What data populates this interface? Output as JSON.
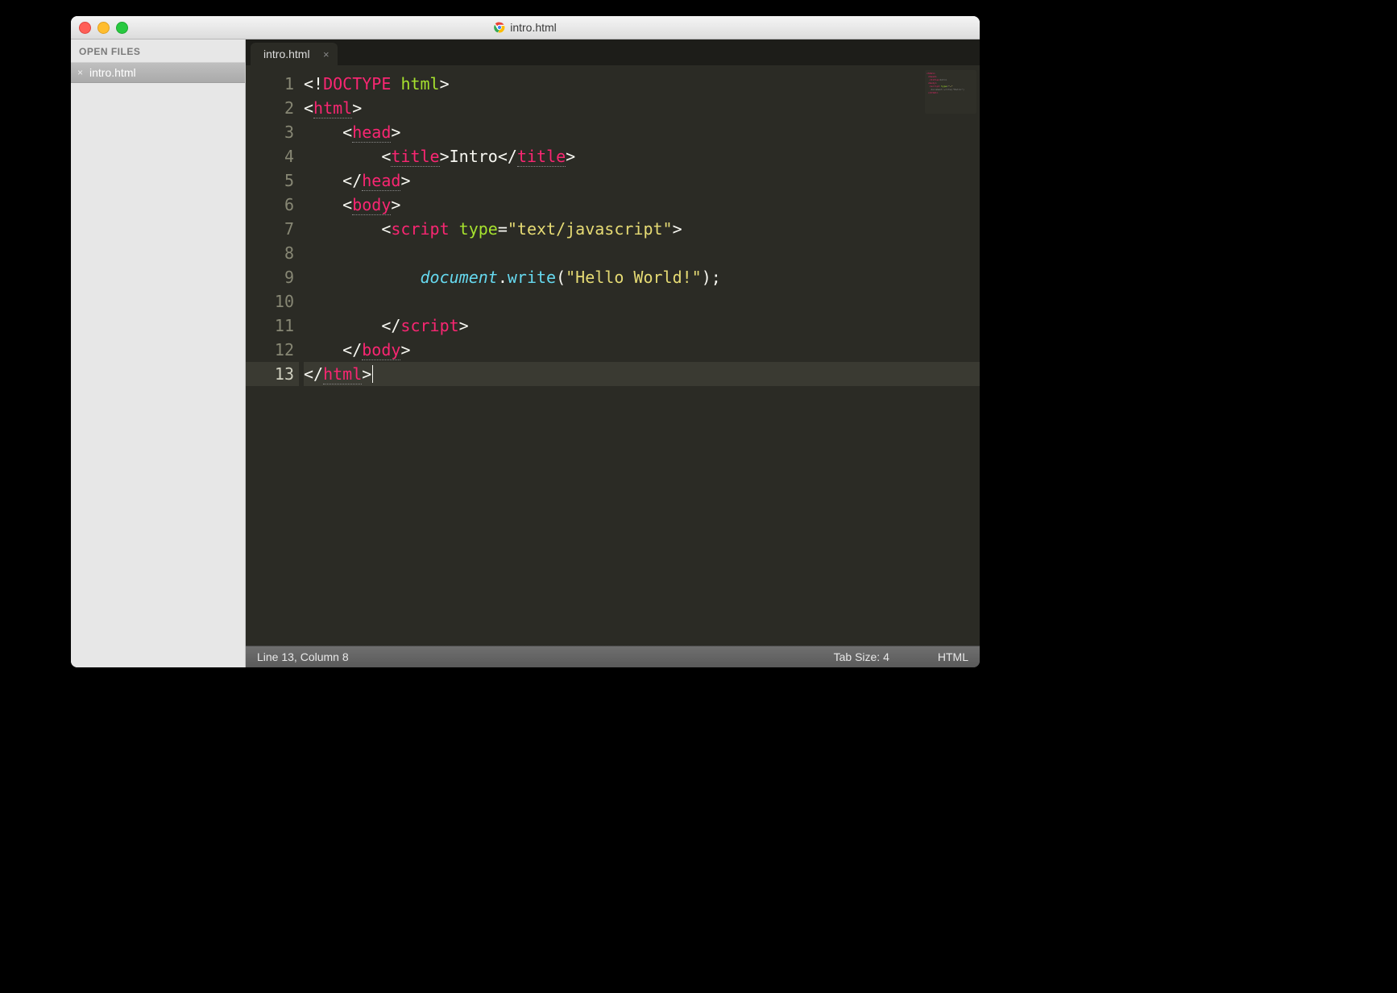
{
  "window": {
    "title": "intro.html"
  },
  "sidebar": {
    "header": "OPEN FILES",
    "open_files": [
      {
        "name": "intro.html"
      }
    ]
  },
  "tabs": [
    {
      "label": "intro.html",
      "active": true
    }
  ],
  "editor": {
    "active_line": 13,
    "lines": [
      {
        "n": 1,
        "tokens": [
          [
            "punc",
            "<!"
          ],
          [
            "tag",
            "DOCTYPE"
          ],
          [
            "plain",
            " "
          ],
          [
            "attr",
            "html"
          ],
          [
            "punc",
            ">"
          ]
        ]
      },
      {
        "n": 2,
        "tokens": [
          [
            "punc",
            "<"
          ],
          [
            "tag",
            "html"
          ],
          [
            "punc",
            ">"
          ]
        ]
      },
      {
        "n": 3,
        "indent": 1,
        "tokens": [
          [
            "punc",
            "<"
          ],
          [
            "tag",
            "head"
          ],
          [
            "punc",
            ">"
          ]
        ]
      },
      {
        "n": 4,
        "indent": 2,
        "tokens": [
          [
            "punc",
            "<"
          ],
          [
            "tag",
            "title"
          ],
          [
            "punc",
            ">"
          ],
          [
            "plain",
            "Intro"
          ],
          [
            "punc",
            "</"
          ],
          [
            "tag",
            "title"
          ],
          [
            "punc",
            ">"
          ]
        ]
      },
      {
        "n": 5,
        "indent": 1,
        "tokens": [
          [
            "punc",
            "</"
          ],
          [
            "tag",
            "head"
          ],
          [
            "punc",
            ">"
          ]
        ]
      },
      {
        "n": 6,
        "indent": 1,
        "tokens": [
          [
            "punc",
            "<"
          ],
          [
            "tag",
            "body"
          ],
          [
            "punc",
            ">"
          ]
        ]
      },
      {
        "n": 7,
        "indent": 2,
        "tokens": [
          [
            "punc",
            "<"
          ],
          [
            "tag",
            "script"
          ],
          [
            "plain",
            " "
          ],
          [
            "attr",
            "type"
          ],
          [
            "punc",
            "="
          ],
          [
            "str",
            "\"text/javascript\""
          ],
          [
            "punc",
            ">"
          ]
        ]
      },
      {
        "n": 8,
        "indent": 2,
        "tokens": []
      },
      {
        "n": 9,
        "indent": 3,
        "tokens": [
          [
            "obj",
            "document"
          ],
          [
            "punc",
            "."
          ],
          [
            "func",
            "write"
          ],
          [
            "punc",
            "("
          ],
          [
            "str",
            "\"Hello World!\""
          ],
          [
            "punc",
            ")"
          ],
          [
            "punc",
            ";"
          ]
        ]
      },
      {
        "n": 10,
        "indent": 2,
        "tokens": []
      },
      {
        "n": 11,
        "indent": 2,
        "tokens": [
          [
            "punc",
            "</"
          ],
          [
            "tag",
            "script"
          ],
          [
            "punc",
            ">"
          ]
        ]
      },
      {
        "n": 12,
        "indent": 1,
        "tokens": [
          [
            "punc",
            "</"
          ],
          [
            "tag",
            "body"
          ],
          [
            "punc",
            ">"
          ]
        ]
      },
      {
        "n": 13,
        "tokens": [
          [
            "punc",
            "</"
          ],
          [
            "tag",
            "html"
          ],
          [
            "punc",
            ">"
          ]
        ],
        "cursor_after": true
      }
    ]
  },
  "status": {
    "position": "Line 13, Column 8",
    "tab_size": "Tab Size: 4",
    "syntax": "HTML"
  }
}
